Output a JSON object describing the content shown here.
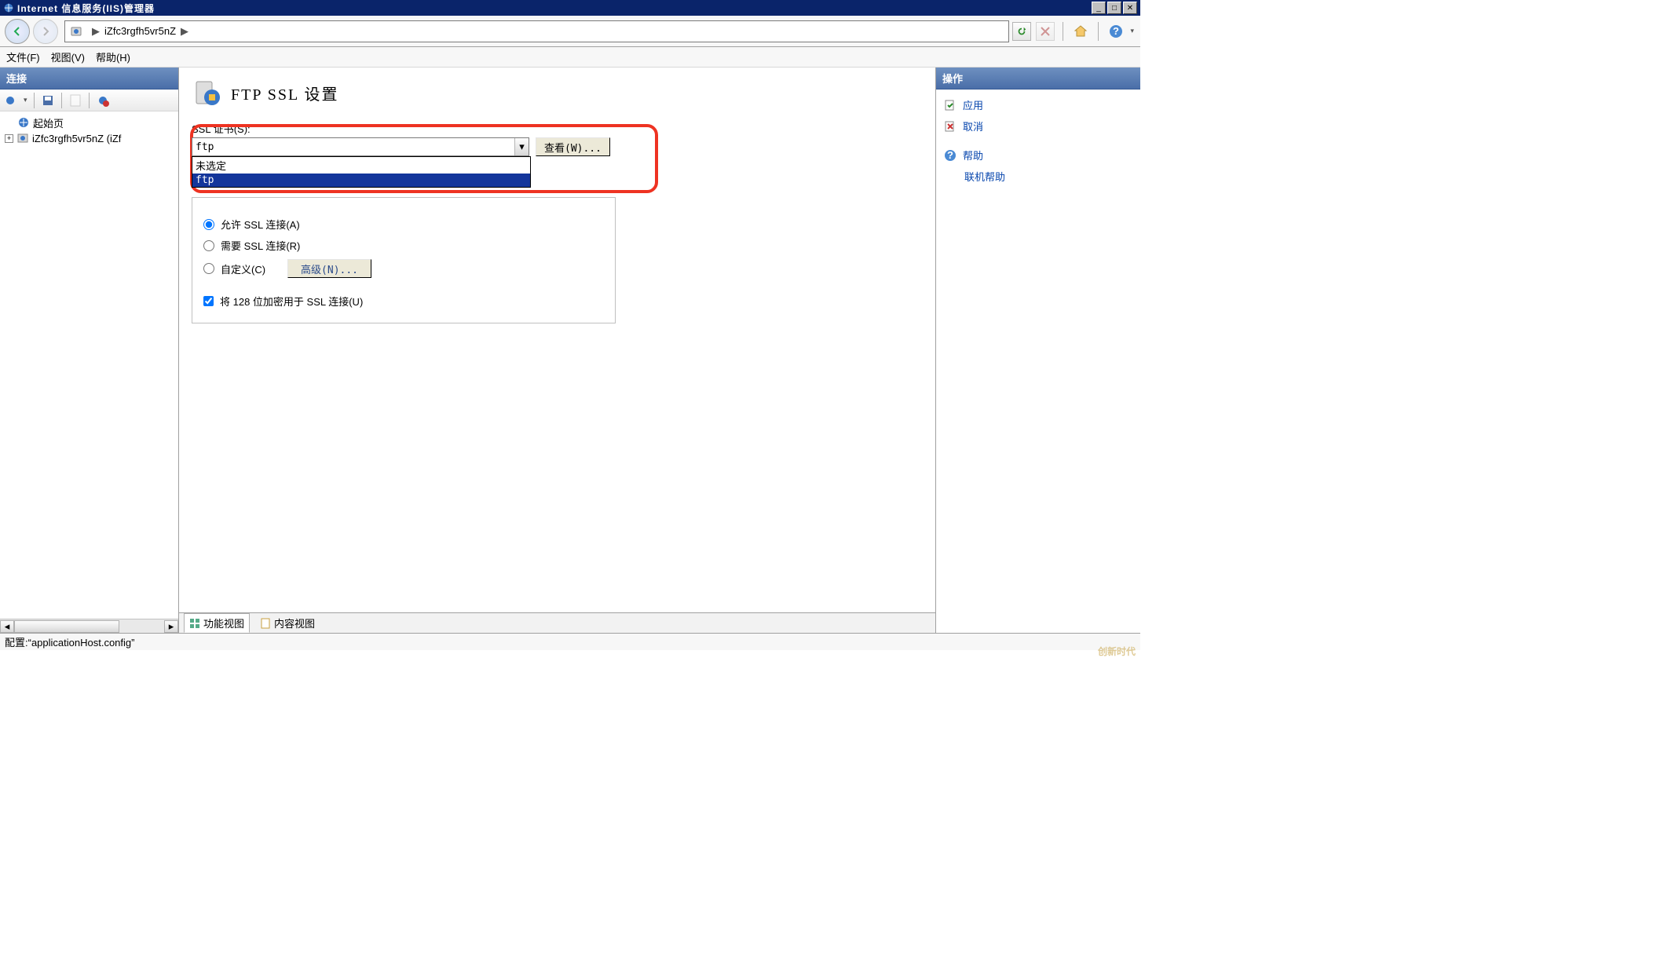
{
  "titlebar": {
    "title": "Internet 信息服务(IIS)管理器"
  },
  "breadcrumb": {
    "segments": [
      "iZfc3rgfh5vr5nZ"
    ]
  },
  "menu": {
    "file": "文件(F)",
    "view": "视图(V)",
    "help": "帮助(H)"
  },
  "left_panel": {
    "header": "连接",
    "tree": {
      "start": "起始页",
      "server": "iZfc3rgfh5vr5nZ (iZf"
    }
  },
  "page": {
    "title": "FTP SSL 设置",
    "cert_label": "SSL 证书(S):",
    "cert_selected": "ftp",
    "cert_options": [
      "未选定",
      "ftp"
    ],
    "view_btn": "查看(W)...",
    "radio_allow": "允许 SSL 连接(A)",
    "radio_require": "需要 SSL 连接(R)",
    "radio_custom": "自定义(C)",
    "advanced_btn": "高级(N)...",
    "checkbox_128": "将 128 位加密用于 SSL 连接(U)"
  },
  "view_tabs": {
    "features": "功能视图",
    "content": "内容视图"
  },
  "actions": {
    "header": "操作",
    "apply": "应用",
    "cancel": "取消",
    "help": "帮助",
    "online_help": "联机帮助"
  },
  "status": {
    "text": "配置:“applicationHost.config”"
  },
  "watermark": "创新时代"
}
